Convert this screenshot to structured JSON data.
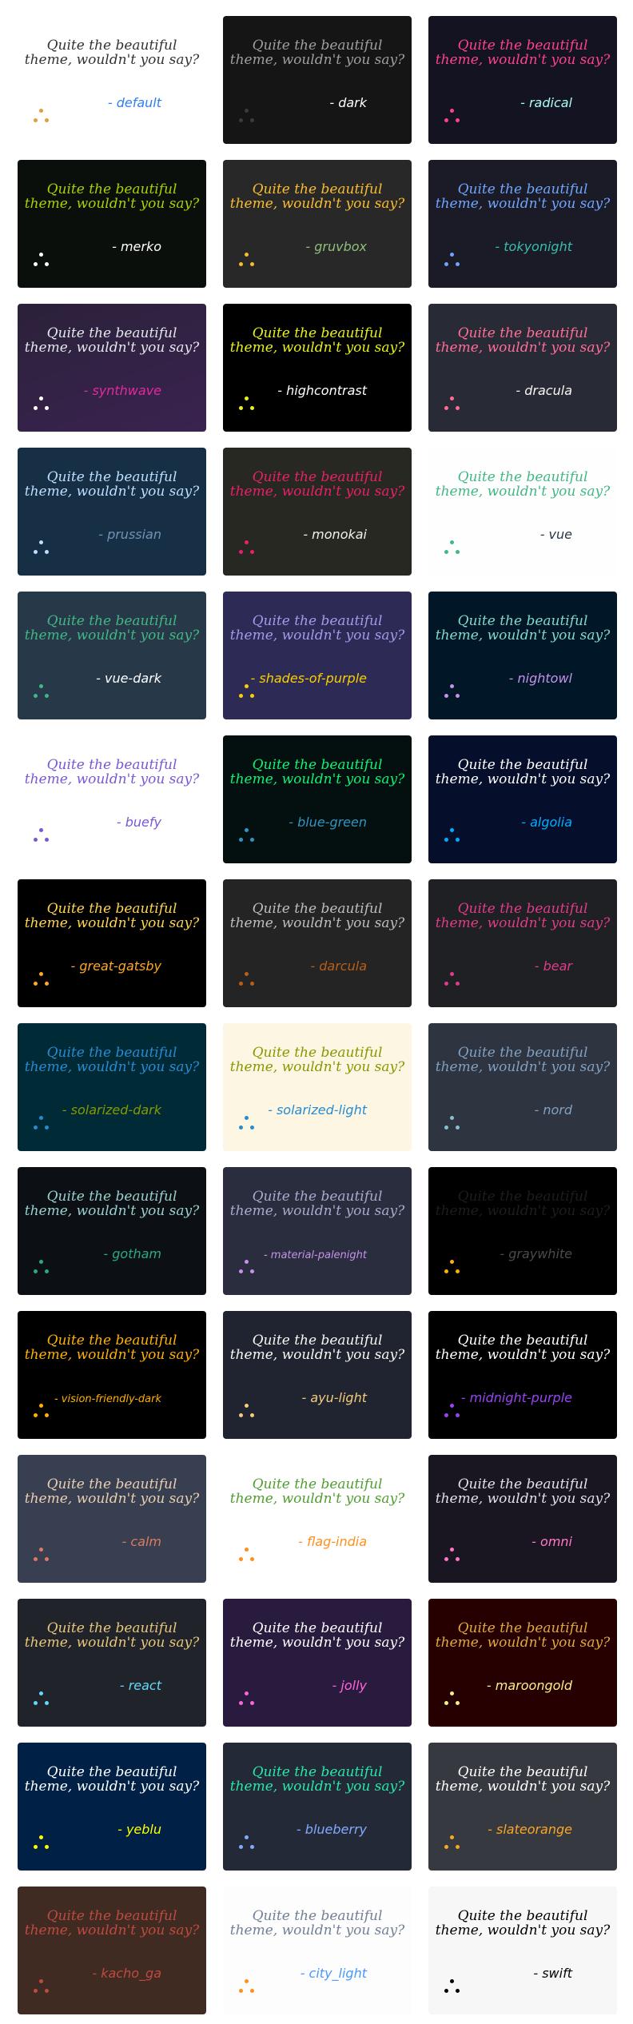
{
  "quote_line1": "Quite the beautiful",
  "quote_line2": "theme, wouldn't you say?",
  "cards": [
    {
      "author": "- default",
      "bg": "#ffffff",
      "quote": "#333333",
      "name": "#2f80ed",
      "icon": "#e09f3e"
    },
    {
      "author": "- dark",
      "bg": "#151515",
      "quote": "#9f9f9f",
      "name": "#ffffff",
      "icon": "#3b3b3b"
    },
    {
      "author": "- radical",
      "bg": "#141321",
      "quote": "#fe428e",
      "name": "#a9fef7",
      "icon": "#f8d847"
    },
    {
      "author": "- merko",
      "bg": "#0a0f0b",
      "quote": "#abd200",
      "name": "#ffffff",
      "icon": "#ffffff"
    },
    {
      "author": "- gruvbox",
      "bg": "#282828",
      "quote": "#fabd2f",
      "name": "#8ec07c",
      "icon": "#fabd2f"
    },
    {
      "author": "- tokyonight",
      "bg": "#1a1b27",
      "quote": "#70a5fd",
      "name": "#38bdae",
      "icon": "#70a5fd"
    },
    {
      "author": "- synthwave",
      "bg": "#2b213a",
      "quote": "#e2e9ec",
      "name": "#e5289e",
      "icon": "#ffffff"
    },
    {
      "author": "- highcontrast",
      "bg": "#000000",
      "quote": "#e7f216",
      "name": "#ffffff",
      "icon": "#e7f216"
    },
    {
      "author": "- dracula",
      "bg": "#282a36",
      "quote": "#ff6e96",
      "name": "#f8f8f2",
      "icon": "#ff6e96"
    },
    {
      "author": "- prussian",
      "bg": "#172f45",
      "quote": "#bddfff",
      "name": "#6e93b5",
      "icon": "#bddfff"
    },
    {
      "author": "- monokai",
      "bg": "#272822",
      "quote": "#eb1f6a",
      "name": "#f1f1eb",
      "icon": "#eb1f6a"
    },
    {
      "author": "- vue",
      "bg": "#fffefe",
      "quote": "#41b883",
      "name": "#273849",
      "icon": "#41b883"
    },
    {
      "author": "- vue-dark",
      "bg": "#273849",
      "quote": "#41b883",
      "name": "#ffffff",
      "icon": "#41b883"
    },
    {
      "author": "- shades-of-purple",
      "bg": "#2d2b55",
      "quote": "#a599e9",
      "name": "#fad000",
      "icon": "#fad000"
    },
    {
      "author": "- nightowl",
      "bg": "#011627",
      "quote": "#7fdbca",
      "name": "#c792ea",
      "icon": "#c792ea"
    },
    {
      "author": "- buefy",
      "bg": "#ffffff",
      "quote": "#7957d5",
      "name": "#7957d5",
      "icon": "#7957d5"
    },
    {
      "author": "- blue-green",
      "bg": "#040f0f",
      "quote": "#2f97c1",
      "name": "#0cf574",
      "icon": "#2f97c1"
    },
    {
      "author": "- algolia",
      "bg": "#050f2c",
      "quote": "#00aeff",
      "name": "#ffffff",
      "icon": "#2dde98"
    },
    {
      "author": "- great-gatsby",
      "bg": "#000000",
      "quote": "#ffa726",
      "name": "#ffd54f",
      "icon": "#ffb74d"
    },
    {
      "author": "- darcula",
      "bg": "#242424",
      "quote": "#ba5f17",
      "name": "#bebebe",
      "icon": "#84628f"
    },
    {
      "author": "- bear",
      "bg": "#1f2023",
      "quote": "#e03c8a",
      "name": "#bcb28d",
      "icon": "#00aeff"
    },
    {
      "author": "- solarized-dark",
      "bg": "#002b36",
      "quote": "#268bd2",
      "name": "#859900",
      "icon": "#b58900"
    },
    {
      "author": "- solarized-light",
      "bg": "#fdf6e3",
      "quote": "#268bd2",
      "name": "#859900",
      "icon": "#b58900"
    },
    {
      "author": "- nord",
      "bg": "#2e3440",
      "quote": "#81a1c1",
      "name": "#d8dee9",
      "icon": "#88c0d0"
    },
    {
      "author": "- gotham",
      "bg": "#0c1014",
      "quote": "#2aa889",
      "name": "#99d1ce",
      "icon": "#599cab"
    },
    {
      "author": "- material-palenight",
      "bg": "#292d3e",
      "quote": "#c792ea",
      "name": "#a6accd",
      "icon": "#89ddff"
    },
    {
      "author": "- graywhite",
      "bg": "#000000",
      "quote": "#24292e",
      "name": "#24292e",
      "icon": "#24292e"
    },
    {
      "author": "- vision-friendly-dark",
      "bg": "#000000",
      "quote": "#ffb000",
      "name": "#ffffff",
      "icon": "#785ef0"
    },
    {
      "author": "- ayu-light",
      "bg": "#1f2430",
      "quote": "#f4cd7c",
      "name": "#f8f8f2",
      "icon": "#73d0ff"
    },
    {
      "author": "- midnight-purple",
      "bg": "#000000",
      "quote": "#9745f5",
      "name": "#ffffff",
      "icon": "#9f4bff"
    },
    {
      "author": "- calm",
      "bg": "#373f51",
      "quote": "#e07a5f",
      "name": "#ebcfb2",
      "icon": "#edae49"
    },
    {
      "author": "- flag-india",
      "bg": "#ffffff",
      "quote": "#ff8f1c",
      "name": "#509e2f",
      "icon": "#250e62"
    },
    {
      "author": "- omni",
      "bg": "#191622",
      "quote": "#ff79c6",
      "name": "#e1e1e6",
      "icon": "#e7de79"
    },
    {
      "author": "- react",
      "bg": "#20232a",
      "quote": "#61dafb",
      "name": "#ffffff",
      "icon": "#61dafb"
    },
    {
      "author": "- jolly",
      "bg": "#291b3e",
      "quote": "#ff64da",
      "name": "#ffffff",
      "icon": "#a960ff"
    },
    {
      "author": "- maroongold",
      "bg": "#260000",
      "quote": "#f7ef8a",
      "name": "#e0aa3e",
      "icon": "#f7ef8a"
    },
    {
      "author": "- yeblu",
      "bg": "#002046",
      "quote": "#ffff00",
      "name": "#ffffff",
      "icon": "#ffff00"
    },
    {
      "author": "- blueberry",
      "bg": "#242938",
      "quote": "#82aaff",
      "name": "#27e8a7",
      "icon": "#89ddff"
    },
    {
      "author": "- slateorange",
      "bg": "#36393f",
      "quote": "#faa627",
      "name": "#ffffff",
      "icon": "#faa627"
    },
    {
      "author": "- kacho_ga",
      "bg": "#402b23",
      "quote": "#bf4a3f",
      "name": "#d9c8a9",
      "icon": "#a64833"
    },
    {
      "author": "- city_light",
      "bg": "#fdfdfd",
      "quote": "#5d8cb3",
      "name": "#718096",
      "icon": "#4798ff"
    },
    {
      "author": "- swift",
      "bg": "#f7f7f7",
      "quote": "#000000",
      "name": "#000000",
      "icon": "#f05237"
    }
  ]
}
